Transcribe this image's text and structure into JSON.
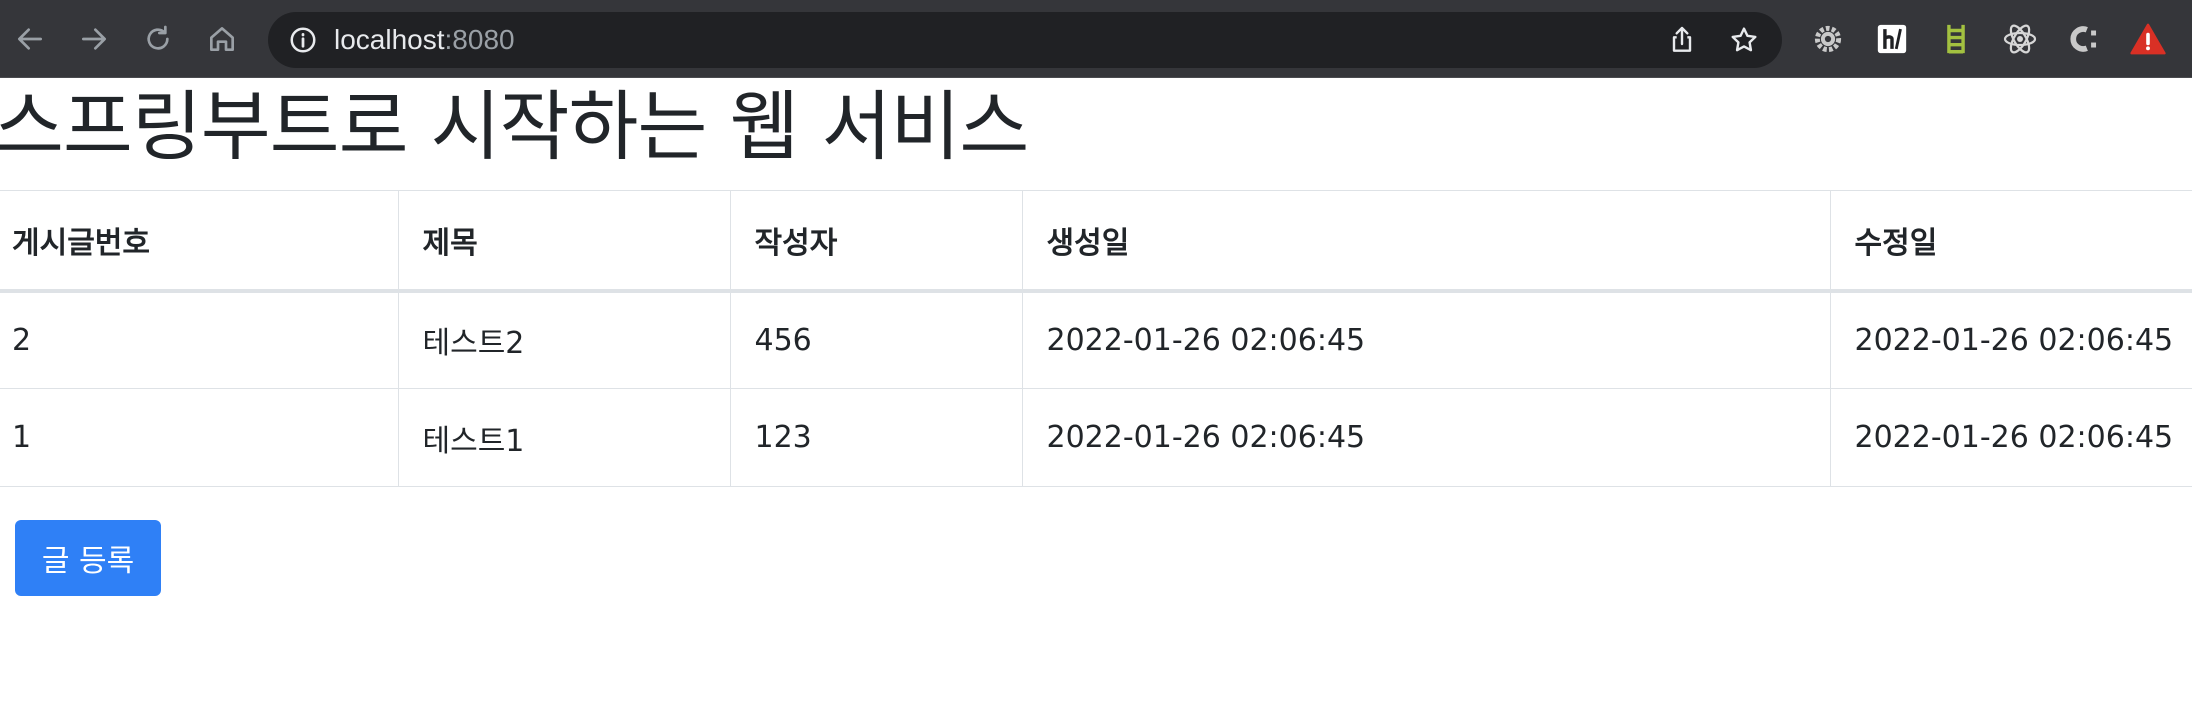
{
  "browser": {
    "url_host": "localhost",
    "url_port": ":8080",
    "icons": [
      "back-icon",
      "forward-icon",
      "reload-icon",
      "home-icon",
      "site-info-icon",
      "share-icon",
      "bookmark-star-icon"
    ],
    "extensions": [
      "gear-extension-icon",
      "hacker-h-extension-icon",
      "ladder-extension-icon",
      "react-atom-extension-icon",
      "c-extension-icon",
      "warning-extension-icon"
    ]
  },
  "page": {
    "title": "스프링부트로 시작하는 웹 서비스"
  },
  "table": {
    "headers": [
      "게시글번호",
      "제목",
      "작성자",
      "생성일",
      "수정일"
    ],
    "rows": [
      [
        "2",
        "테스트2",
        "456",
        "2022-01-26 02:06:45",
        "2022-01-26 02:06:45"
      ],
      [
        "1",
        "테스트1",
        "123",
        "2022-01-26 02:06:45",
        "2022-01-26 02:06:45"
      ]
    ]
  },
  "actions": {
    "write_label": "글 등록"
  },
  "colors": {
    "toolbar_bg": "#35363a",
    "omnibox_bg": "#202124",
    "primary_button": "#2f80f6",
    "ladder_icon": "#a3c140",
    "warning_icon": "#d93025"
  }
}
